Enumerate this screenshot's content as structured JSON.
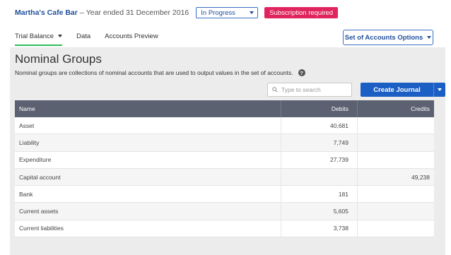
{
  "header": {
    "company": "Martha's Cafe Bar",
    "separator": "–",
    "period": "Year ended 31 December 2016",
    "status_value": "In Progress",
    "subscription_badge": "Subscription required"
  },
  "tabs": [
    {
      "label": "Trial Balance",
      "active": true
    },
    {
      "label": "Data"
    },
    {
      "label": "Accounts Preview"
    }
  ],
  "actions": {
    "set_of_accounts_label": "Set of Accounts Options",
    "create_journal_label": "Create Journal"
  },
  "main": {
    "title": "Nominal Groups",
    "description": "Nominal groups are collections of nominal accounts that are used to output values in the set of accounts.",
    "search_placeholder": "Type to search"
  },
  "table": {
    "columns": [
      "Name",
      "Debits",
      "Credits"
    ],
    "rows": [
      {
        "name": "Asset",
        "debit": "40,681",
        "credit": ""
      },
      {
        "name": "Liability",
        "debit": "7,749",
        "credit": ""
      },
      {
        "name": "Expenditure",
        "debit": "27,739",
        "credit": ""
      },
      {
        "name": "Capital account",
        "debit": "",
        "credit": "49,238"
      },
      {
        "name": "Bank",
        "debit": "181",
        "credit": ""
      },
      {
        "name": "Current assets",
        "debit": "5,605",
        "credit": ""
      },
      {
        "name": "Current liabilities",
        "debit": "3,738",
        "credit": ""
      }
    ]
  },
  "colors": {
    "brand_blue": "#1c5fc4",
    "badge_red": "#e0245e",
    "active_tab_green": "#2ebd59",
    "table_header": "#5b6170"
  }
}
